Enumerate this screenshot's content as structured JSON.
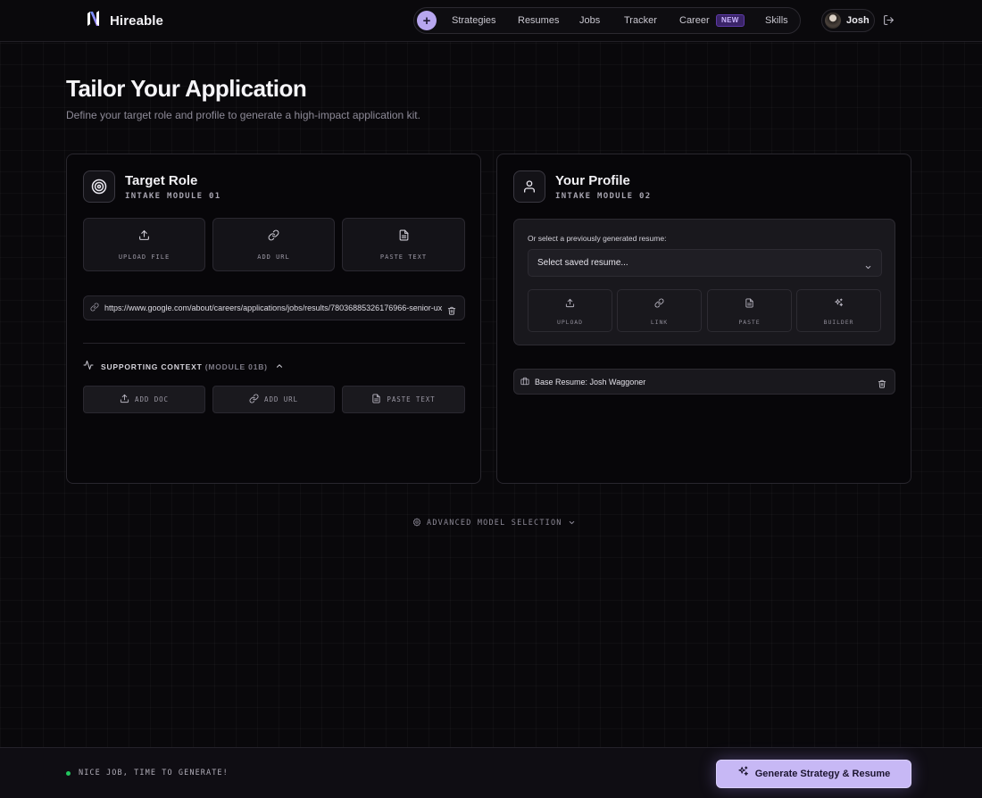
{
  "app": {
    "name": "Hireable",
    "logo_icon": "hireable-logo-icon"
  },
  "nav": {
    "items": [
      {
        "label": "Strategies"
      },
      {
        "label": "Resumes"
      },
      {
        "label": "Jobs"
      },
      {
        "label": "Tracker"
      },
      {
        "label": "Career",
        "badge": "NEW"
      },
      {
        "label": "Skills"
      }
    ],
    "plus_icon": "plus-icon"
  },
  "user": {
    "name": "Josh",
    "logout_icon": "logout-icon"
  },
  "page": {
    "title": "Tailor Your Application",
    "subtitle": "Define your target role and profile to generate a high-impact application kit."
  },
  "target_role": {
    "title": "Target Role",
    "module": "INTAKE MODULE 01",
    "icon": "target-icon",
    "actions": [
      {
        "label": "UPLOAD FILE",
        "icon": "upload-icon"
      },
      {
        "label": "ADD URL",
        "icon": "link-icon"
      },
      {
        "label": "PASTE TEXT",
        "icon": "document-icon"
      }
    ],
    "url_value": "https://www.google.com/about/careers/applications/jobs/results/78036885326176966-senior-ux",
    "supporting": {
      "label": "SUPPORTING CONTEXT",
      "module": "(MODULE 01B)",
      "actions": [
        {
          "label": "ADD DOC",
          "icon": "upload-icon"
        },
        {
          "label": "ADD URL",
          "icon": "link-icon"
        },
        {
          "label": "PASTE TEXT",
          "icon": "document-icon"
        }
      ]
    }
  },
  "profile": {
    "title": "Your Profile",
    "module": "INTAKE MODULE 02",
    "icon": "user-icon",
    "hint": "Or select a previously generated resume:",
    "select_value": "Select saved resume...",
    "actions": [
      {
        "label": "UPLOAD",
        "icon": "upload-icon"
      },
      {
        "label": "LINK",
        "icon": "link-icon"
      },
      {
        "label": "PASTE",
        "icon": "document-icon"
      },
      {
        "label": "BUILDER",
        "icon": "sparkles-icon"
      }
    ],
    "base_resume": "Base Resume: Josh Waggoner"
  },
  "advanced": {
    "label": "ADVANCED MODEL SELECTION"
  },
  "footer": {
    "status": "NICE JOB, TIME TO GENERATE!",
    "status_color": "#22c55e",
    "generate_label": "Generate Strategy & Resume"
  },
  "colors": {
    "accent": "#c7b8f5",
    "background": "#09080b",
    "badge": "#3a2468"
  }
}
